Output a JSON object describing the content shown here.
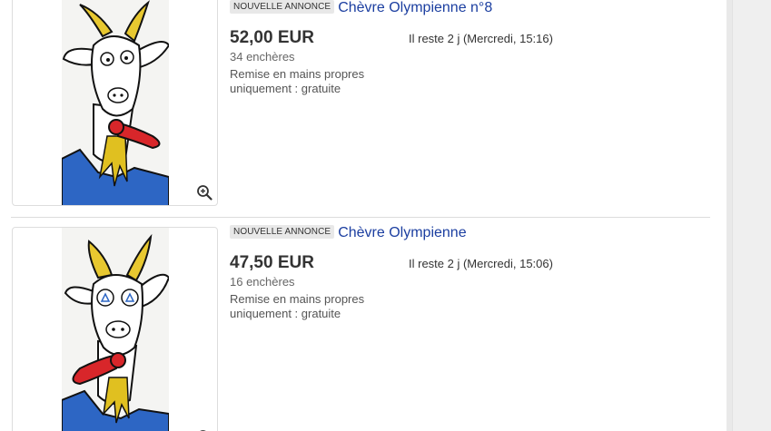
{
  "listings": [
    {
      "badge": "NOUVELLE ANNONCE",
      "title": "Chèvre Olympienne n°8",
      "price": "52,00 EUR",
      "bids": "34 enchères",
      "time_left": "Il reste 2 j (Mercredi, 15:16)",
      "pickup_line1": "Remise en mains propres",
      "pickup_line2": "uniquement : gratuite",
      "thumbnail_icon": "goat-drawing-image",
      "zoom_icon": "zoom-in-icon"
    },
    {
      "badge": "NOUVELLE ANNONCE",
      "title": "Chèvre Olympienne",
      "price": "47,50 EUR",
      "bids": "16 enchères",
      "time_left": "Il reste 2 j (Mercredi, 15:06)",
      "pickup_line1": "Remise en mains propres",
      "pickup_line2": "uniquement : gratuite",
      "thumbnail_icon": "goat-drawing-image",
      "zoom_icon": "zoom-in-icon"
    }
  ],
  "colors": {
    "link": "#1b3ea0",
    "badge_bg": "#e8e8e8",
    "goat_horn": "#e8c830",
    "goat_tongue": "#d8262a",
    "goat_shirt": "#2d66c4"
  }
}
